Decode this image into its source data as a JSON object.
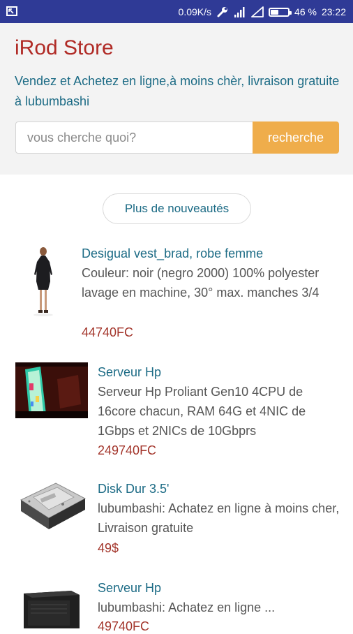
{
  "status_bar": {
    "speed": "0.09K/s",
    "battery": "46 %",
    "battery_level": 0.46,
    "time": "23:22",
    "icons": [
      "screenshot-icon",
      "wrench-icon",
      "signal-icon",
      "wifi-icon",
      "battery-icon"
    ]
  },
  "header": {
    "brand": "iRod Store",
    "tagline": "Vendez et Achetez en ligne,à moins chèr, livraison gratuite à lubumbashi"
  },
  "search": {
    "placeholder": "vous cherche quoi?",
    "button_label": "recherche"
  },
  "more_button": "Plus de nouveautés",
  "products": [
    {
      "title": "Desigual vest_brad, robe femme",
      "description": "Couleur: noir (negro 2000) 100% polyester lavage en machine, 30° max. manches 3/4",
      "price": "44740FC",
      "image_icon": "dress-image"
    },
    {
      "title": "Serveur Hp",
      "description": "Serveur Hp Proliant Gen10 4CPU de 16core chacun, RAM 64G et 4NIC de 1Gbps et 2NICs de 10Gbprs",
      "price": "249740FC",
      "image_icon": "server-photo-image"
    },
    {
      "title": "Disk Dur 3.5'",
      "description": "lubumbashi: Achatez en ligne à moins cher, Livraison gratuite",
      "price": "49$",
      "image_icon": "hard-disk-image"
    },
    {
      "title": "Serveur Hp",
      "description": "lubumbashi: Achatez en ligne ...",
      "price": "49740FC",
      "image_icon": "server-tower-image"
    }
  ],
  "colors": {
    "status_bar": "#2f3a96",
    "brand": "#b02a25",
    "link": "#1c6b85",
    "price": "#a3352b",
    "search_button": "#efad4b"
  }
}
